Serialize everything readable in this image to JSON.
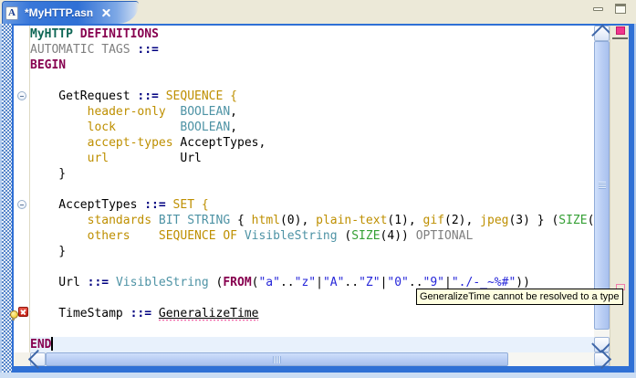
{
  "tab": {
    "title": "*MyHTTP.asn",
    "icon_letter": "A"
  },
  "window_controls": {
    "minimize_icon": "minimize",
    "maximize_icon": "maximize"
  },
  "tooltip": {
    "text": "GeneralizeTime cannot be resolved to a type"
  },
  "colors": {
    "frame_blue": "#2F70D5",
    "tab_bar_bg": "#ECE9D8",
    "current_line": "#E8F1FC",
    "keyword_magenta": "#87004F",
    "module_teal": "#0E6655",
    "assign_navy": "#000080",
    "field_gold": "#BE8F00",
    "type_teal": "#4E93A5",
    "size_green": "#35A035",
    "string_blue": "#2626D9",
    "comment_gray": "#7F7F7F",
    "error_squiggle": "#F25CA2",
    "overview_marker": "#F0368C",
    "tooltip_bg": "#FFFFE1"
  },
  "editor": {
    "lines": [
      {
        "segs": [
          [
            "MyHTTP",
            "mod"
          ],
          [
            " ",
            "p"
          ],
          [
            "DEFINITIONS",
            "kw"
          ]
        ]
      },
      {
        "segs": [
          [
            "AUTOMATIC TAGS ",
            "gray"
          ],
          [
            "::=",
            "op"
          ]
        ]
      },
      {
        "segs": [
          [
            "BEGIN",
            "kw"
          ]
        ]
      },
      {
        "segs": []
      },
      {
        "fold": true,
        "segs": [
          [
            "    GetRequest ",
            "p"
          ],
          [
            "::=",
            "op"
          ],
          [
            " ",
            "p"
          ],
          [
            "SEQUENCE {",
            "gold"
          ]
        ]
      },
      {
        "segs": [
          [
            "        ",
            "p"
          ],
          [
            "header-only",
            "gold"
          ],
          [
            "  ",
            "p"
          ],
          [
            "BOOLEAN",
            "type"
          ],
          [
            ",",
            "p"
          ]
        ]
      },
      {
        "segs": [
          [
            "        ",
            "p"
          ],
          [
            "lock",
            "gold"
          ],
          [
            "         ",
            "p"
          ],
          [
            "BOOLEAN",
            "type"
          ],
          [
            ",",
            "p"
          ]
        ]
      },
      {
        "segs": [
          [
            "        ",
            "p"
          ],
          [
            "accept-types",
            "gold"
          ],
          [
            " ",
            "p"
          ],
          [
            "AcceptTypes,",
            "p"
          ]
        ]
      },
      {
        "segs": [
          [
            "        ",
            "p"
          ],
          [
            "url",
            "gold"
          ],
          [
            "          ",
            "p"
          ],
          [
            "Url",
            "p"
          ]
        ]
      },
      {
        "segs": [
          [
            "    }",
            "p"
          ]
        ]
      },
      {
        "segs": []
      },
      {
        "fold": true,
        "segs": [
          [
            "    AcceptTypes ",
            "p"
          ],
          [
            "::=",
            "op"
          ],
          [
            " ",
            "p"
          ],
          [
            "SET {",
            "gold"
          ]
        ]
      },
      {
        "segs": [
          [
            "        ",
            "p"
          ],
          [
            "standards",
            "gold"
          ],
          [
            " ",
            "p"
          ],
          [
            "BIT STRING",
            "type"
          ],
          [
            " { ",
            "p"
          ],
          [
            "html",
            "gold"
          ],
          [
            "(0), ",
            "p"
          ],
          [
            "plain-text",
            "gold"
          ],
          [
            "(1), ",
            "p"
          ],
          [
            "gif",
            "gold"
          ],
          [
            "(2), ",
            "p"
          ],
          [
            "jpeg",
            "gold"
          ],
          [
            "(3) } (",
            "p"
          ],
          [
            "SIZE",
            "green"
          ],
          [
            "(",
            "p"
          ]
        ]
      },
      {
        "segs": [
          [
            "        ",
            "p"
          ],
          [
            "others",
            "gold"
          ],
          [
            "    ",
            "p"
          ],
          [
            "SEQUENCE OF",
            "gold"
          ],
          [
            " ",
            "p"
          ],
          [
            "VisibleString",
            "type"
          ],
          [
            " (",
            "p"
          ],
          [
            "SIZE",
            "green"
          ],
          [
            "(4)) ",
            "p"
          ],
          [
            "OPTIONAL",
            "gray"
          ]
        ]
      },
      {
        "segs": [
          [
            "    }",
            "p"
          ]
        ]
      },
      {
        "segs": []
      },
      {
        "segs": [
          [
            "    Url ",
            "p"
          ],
          [
            "::=",
            "op"
          ],
          [
            " ",
            "p"
          ],
          [
            "VisibleString",
            "type"
          ],
          [
            " (",
            "p"
          ],
          [
            "FROM",
            "kw"
          ],
          [
            "(",
            "p"
          ],
          [
            "\"a\"",
            "str"
          ],
          [
            "..",
            "p"
          ],
          [
            "\"z\"",
            "str"
          ],
          [
            "|",
            "p"
          ],
          [
            "\"A\"",
            "str"
          ],
          [
            "..",
            "p"
          ],
          [
            "\"Z\"",
            "str"
          ],
          [
            "|",
            "p"
          ],
          [
            "\"0\"",
            "str"
          ],
          [
            "..",
            "p"
          ],
          [
            "\"9\"",
            "str"
          ],
          [
            "|",
            "p"
          ],
          [
            "\"./-_~%#\"",
            "str"
          ],
          [
            "))",
            "p"
          ]
        ]
      },
      {
        "segs": []
      },
      {
        "error_icon": true,
        "segs": [
          [
            "    TimeStamp ",
            "p"
          ],
          [
            "::=",
            "op"
          ],
          [
            " ",
            "p"
          ],
          [
            "GeneralizeTime",
            "err"
          ]
        ]
      },
      {
        "segs": []
      },
      {
        "current": true,
        "caret": true,
        "segs": [
          [
            "END",
            "kw"
          ]
        ]
      }
    ]
  }
}
